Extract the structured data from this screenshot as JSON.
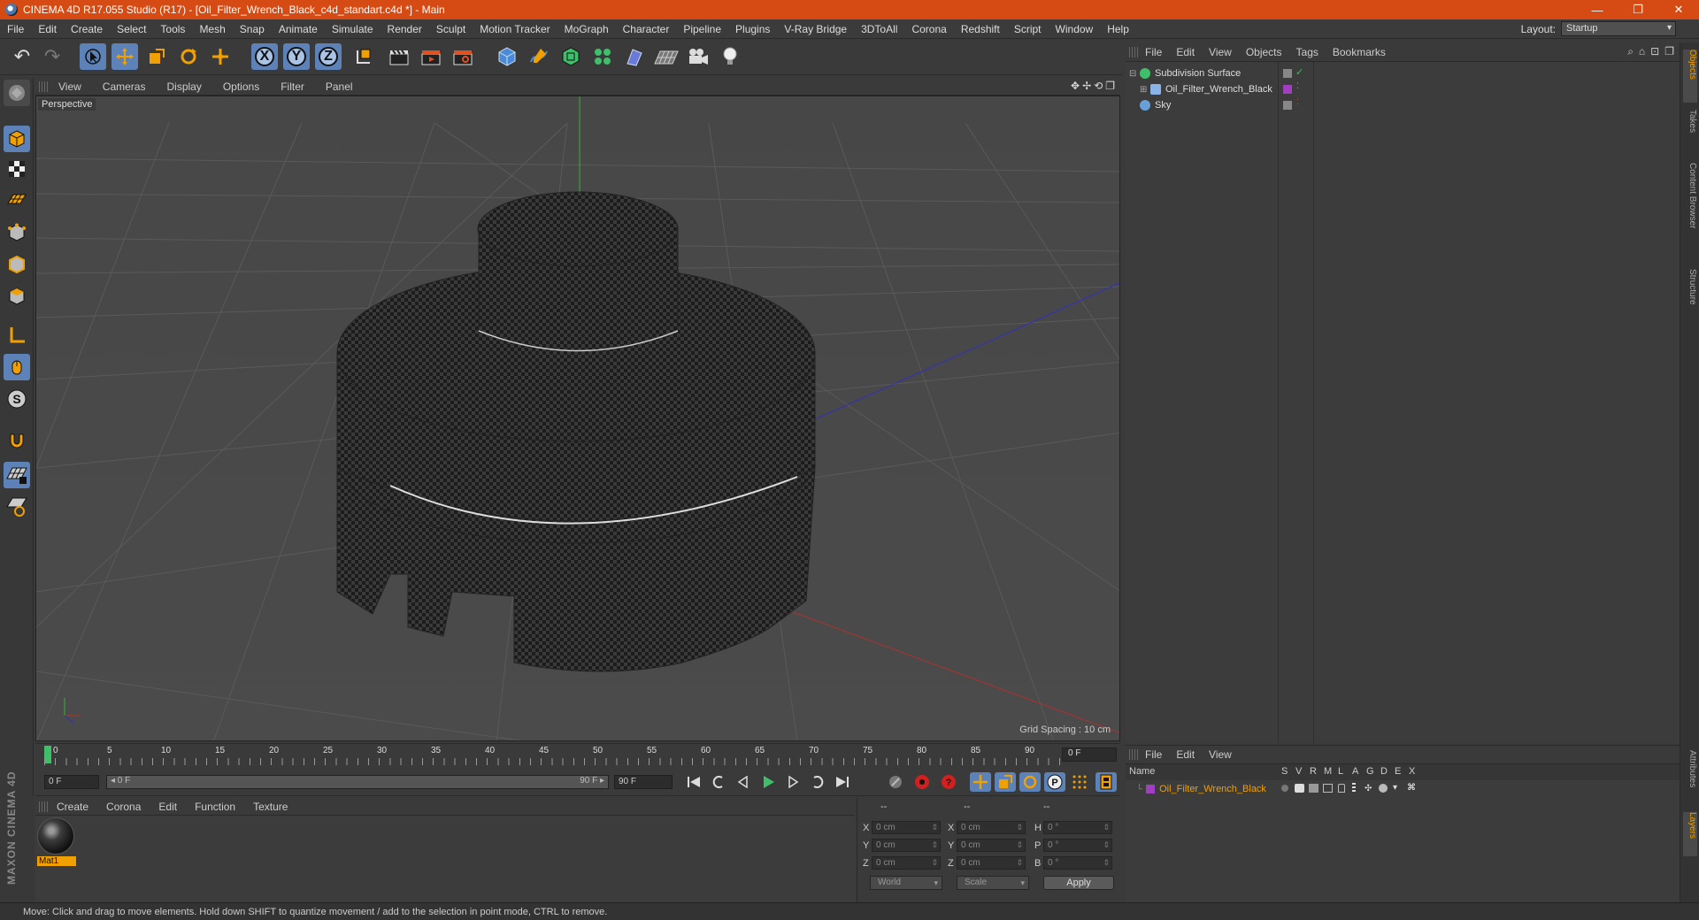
{
  "window": {
    "title": "CINEMA 4D R17.055 Studio (R17) - [Oil_Filter_Wrench_Black_c4d_standart.c4d *] - Main",
    "minimize": "—",
    "maximize": "❐",
    "close": "✕"
  },
  "menu": [
    "File",
    "Edit",
    "Create",
    "Select",
    "Tools",
    "Mesh",
    "Snap",
    "Animate",
    "Simulate",
    "Render",
    "Sculpt",
    "Motion Tracker",
    "MoGraph",
    "Character",
    "Pipeline",
    "Plugins",
    "V-Ray Bridge",
    "3DToAll",
    "Corona",
    "Redshift",
    "Script",
    "Window",
    "Help"
  ],
  "layout": {
    "label": "Layout:",
    "value": "Startup"
  },
  "toolbar": {
    "undo": "↶",
    "redo": "↷",
    "axis_x": "X",
    "axis_y": "Y",
    "axis_z": "Z"
  },
  "viewport": {
    "menu": [
      "View",
      "Cameras",
      "Display",
      "Options",
      "Filter",
      "Panel"
    ],
    "label": "Perspective",
    "grid_spacing": "Grid Spacing : 10 cm",
    "nav": [
      "✥",
      "✢",
      "⟲",
      "❐"
    ]
  },
  "timeline": {
    "ticks": [
      "0",
      "5",
      "10",
      "15",
      "20",
      "25",
      "30",
      "35",
      "40",
      "45",
      "50",
      "55",
      "60",
      "65",
      "70",
      "75",
      "80",
      "85",
      "90"
    ],
    "current": "0 F"
  },
  "transport": {
    "start": "0 F",
    "range_start": "◂ 0 F",
    "range_end": "90 F ▸",
    "end": "90 F"
  },
  "materials": {
    "menu": [
      "Create",
      "Corona",
      "Edit",
      "Function",
      "Texture"
    ],
    "items": [
      {
        "name": "Mat1"
      }
    ]
  },
  "brand": "MAXON CINEMA 4D",
  "coords": {
    "headers": [
      "--",
      "--",
      "--"
    ],
    "rows": [
      {
        "a": "X",
        "av": "0 cm",
        "b": "X",
        "bv": "0 cm",
        "c": "H",
        "cv": "0 °"
      },
      {
        "a": "Y",
        "av": "0 cm",
        "b": "Y",
        "bv": "0 cm",
        "c": "P",
        "cv": "0 °"
      },
      {
        "a": "Z",
        "av": "0 cm",
        "b": "Z",
        "bv": "0 cm",
        "c": "B",
        "cv": "0 °"
      }
    ],
    "mode1": "World",
    "mode2": "Scale",
    "apply": "Apply"
  },
  "objects": {
    "menu": [
      "File",
      "Edit",
      "View",
      "Objects",
      "Tags",
      "Bookmarks"
    ],
    "items": [
      {
        "name": "Subdivision Surface",
        "color": "#3fbf6a"
      },
      {
        "name": "Oil_Filter_Wrench_Black",
        "color": "#8ab4e8"
      },
      {
        "name": "Sky",
        "color": "#6aa0d8"
      }
    ]
  },
  "side_tabs": [
    "Objects",
    "Takes",
    "Content Browser",
    "Structure",
    "Attributes",
    "Layers"
  ],
  "layers": {
    "menu": [
      "File",
      "Edit",
      "View"
    ],
    "columns": [
      "Name",
      "S",
      "V",
      "R",
      "M",
      "L",
      "A",
      "G",
      "D",
      "E",
      "X"
    ],
    "items": [
      {
        "name": "Oil_Filter_Wrench_Black",
        "color": "#a040c0"
      }
    ]
  },
  "status": "Move: Click and drag to move elements. Hold down SHIFT to quantize movement / add to the selection in point mode, CTRL to remove."
}
